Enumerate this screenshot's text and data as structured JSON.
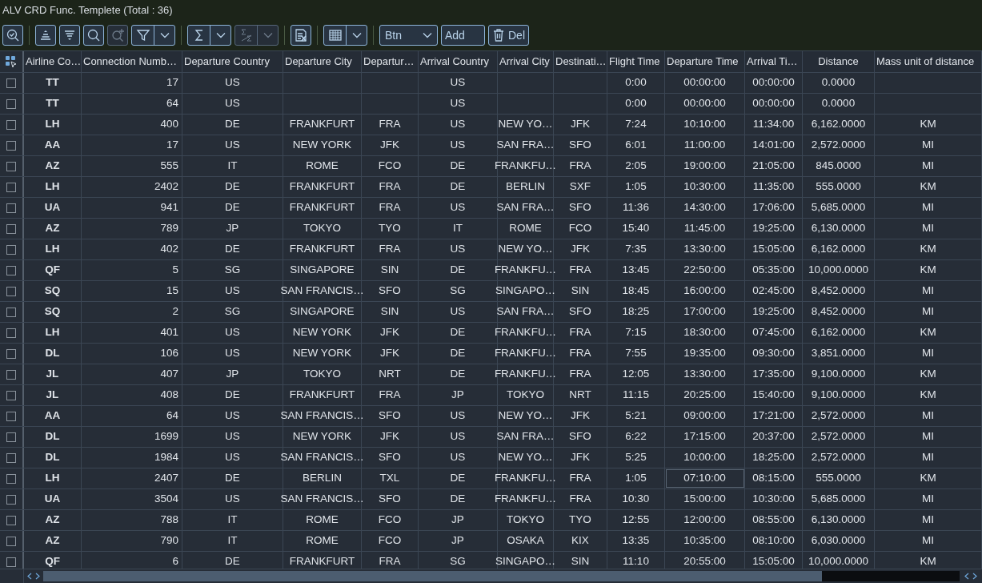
{
  "window": {
    "title": "ALV CRD Func. Templete (Total : 36)"
  },
  "toolbar": [
    {
      "kind": "zoom",
      "disabled": false
    },
    {
      "kind": "separator"
    },
    {
      "kind": "sortup",
      "disabled": false
    },
    {
      "kind": "sortdown",
      "disabled": false
    },
    {
      "kind": "search",
      "disabled": false
    },
    {
      "kind": "zoomin",
      "disabled": true
    },
    {
      "kind": "filter",
      "disabled": false,
      "dropdown": true
    },
    {
      "kind": "separator"
    },
    {
      "kind": "sum",
      "disabled": false,
      "dropdown": true
    },
    {
      "kind": "subtotal",
      "disabled": true,
      "dropdown": true
    },
    {
      "kind": "separator"
    },
    {
      "kind": "export",
      "disabled": false
    },
    {
      "kind": "separator"
    },
    {
      "kind": "layout",
      "disabled": false,
      "dropdown": true
    },
    {
      "kind": "separator"
    },
    {
      "kind": "select",
      "label": "Btn",
      "disabled": false
    },
    {
      "kind": "button",
      "label": "Add",
      "disabled": false
    },
    {
      "kind": "delete",
      "label": "Del",
      "disabled": false
    }
  ],
  "table": {
    "columns": [
      {
        "label": "Airline Co…"
      },
      {
        "label": "Connection Numb…"
      },
      {
        "label": "Departure Country"
      },
      {
        "label": "Departure City"
      },
      {
        "label": "Departur…"
      },
      {
        "label": "Arrival Country"
      },
      {
        "label": "Arrival City"
      },
      {
        "label": "Destinati…"
      },
      {
        "label": "Flight Time"
      },
      {
        "label": "Departure Time"
      },
      {
        "label": "Arrival Ti…"
      },
      {
        "label": "Distance"
      },
      {
        "label": "Mass unit of distance"
      }
    ],
    "rows": [
      {
        "checked": false,
        "current": false,
        "cells": [
          "TT",
          "17",
          "US",
          null,
          null,
          "US",
          null,
          null,
          "0:00",
          "00:00:00",
          "00:00:00",
          "0.0000",
          null
        ]
      },
      {
        "checked": false,
        "current": false,
        "cells": [
          "TT",
          "64",
          "US",
          null,
          null,
          "US",
          null,
          null,
          "0:00",
          "00:00:00",
          "00:00:00",
          "0.0000",
          null
        ]
      },
      {
        "checked": false,
        "current": false,
        "cells": [
          "LH",
          "400",
          "DE",
          "FRANKFURT",
          "FRA",
          "US",
          "NEW YO…",
          "JFK",
          "7:24",
          "10:10:00",
          "11:34:00",
          "6,162.0000",
          "KM"
        ]
      },
      {
        "checked": false,
        "current": false,
        "cells": [
          "AA",
          "17",
          "US",
          "NEW YORK",
          "JFK",
          "US",
          "SAN FRA…",
          "SFO",
          "6:01",
          "11:00:00",
          "14:01:00",
          "2,572.0000",
          "MI"
        ]
      },
      {
        "checked": false,
        "current": false,
        "cells": [
          "AZ",
          "555",
          "IT",
          "ROME",
          "FCO",
          "DE",
          "FRANKFU…",
          "FRA",
          "2:05",
          "19:00:00",
          "21:05:00",
          "845.0000",
          "MI"
        ]
      },
      {
        "checked": false,
        "current": false,
        "cells": [
          "LH",
          "2402",
          "DE",
          "FRANKFURT",
          "FRA",
          "DE",
          "BERLIN",
          "SXF",
          "1:05",
          "10:30:00",
          "11:35:00",
          "555.0000",
          "KM"
        ]
      },
      {
        "checked": false,
        "current": false,
        "cells": [
          "UA",
          "941",
          "DE",
          "FRANKFURT",
          "FRA",
          "US",
          "SAN FRA…",
          "SFO",
          "11:36",
          "14:30:00",
          "17:06:00",
          "5,685.0000",
          "MI"
        ]
      },
      {
        "checked": false,
        "current": false,
        "cells": [
          "AZ",
          "789",
          "JP",
          "TOKYO",
          "TYO",
          "IT",
          "ROME",
          "FCO",
          "15:40",
          "11:45:00",
          "19:25:00",
          "6,130.0000",
          "MI"
        ]
      },
      {
        "checked": false,
        "current": false,
        "cells": [
          "LH",
          "402",
          "DE",
          "FRANKFURT",
          "FRA",
          "US",
          "NEW YO…",
          "JFK",
          "7:35",
          "13:30:00",
          "15:05:00",
          "6,162.0000",
          "KM"
        ]
      },
      {
        "checked": false,
        "current": false,
        "cells": [
          "QF",
          "5",
          "SG",
          "SINGAPORE",
          "SIN",
          "DE",
          "FRANKFU…",
          "FRA",
          "13:45",
          "22:50:00",
          "05:35:00",
          "10,000.0000",
          "KM"
        ]
      },
      {
        "checked": false,
        "current": false,
        "cells": [
          "SQ",
          "15",
          "US",
          "SAN FRANCIS…",
          "SFO",
          "SG",
          "SINGAPO…",
          "SIN",
          "18:45",
          "16:00:00",
          "02:45:00",
          "8,452.0000",
          "MI"
        ]
      },
      {
        "checked": false,
        "current": false,
        "cells": [
          "SQ",
          "2",
          "SG",
          "SINGAPORE",
          "SIN",
          "US",
          "SAN FRA…",
          "SFO",
          "18:25",
          "17:00:00",
          "19:25:00",
          "8,452.0000",
          "MI"
        ]
      },
      {
        "checked": false,
        "current": false,
        "cells": [
          "LH",
          "401",
          "US",
          "NEW YORK",
          "JFK",
          "DE",
          "FRANKFU…",
          "FRA",
          "7:15",
          "18:30:00",
          "07:45:00",
          "6,162.0000",
          "KM"
        ]
      },
      {
        "checked": false,
        "current": false,
        "cells": [
          "DL",
          "106",
          "US",
          "NEW YORK",
          "JFK",
          "DE",
          "FRANKFU…",
          "FRA",
          "7:55",
          "19:35:00",
          "09:30:00",
          "3,851.0000",
          "MI"
        ]
      },
      {
        "checked": false,
        "current": false,
        "cells": [
          "JL",
          "407",
          "JP",
          "TOKYO",
          "NRT",
          "DE",
          "FRANKFU…",
          "FRA",
          "12:05",
          "13:30:00",
          "17:35:00",
          "9,100.0000",
          "KM"
        ]
      },
      {
        "checked": false,
        "current": false,
        "cells": [
          "JL",
          "408",
          "DE",
          "FRANKFURT",
          "FRA",
          "JP",
          "TOKYO",
          "NRT",
          "11:15",
          "20:25:00",
          "15:40:00",
          "9,100.0000",
          "KM"
        ]
      },
      {
        "checked": false,
        "current": false,
        "cells": [
          "AA",
          "64",
          "US",
          "SAN FRANCIS…",
          "SFO",
          "US",
          "NEW YO…",
          "JFK",
          "5:21",
          "09:00:00",
          "17:21:00",
          "2,572.0000",
          "MI"
        ]
      },
      {
        "checked": false,
        "current": false,
        "cells": [
          "DL",
          "1699",
          "US",
          "NEW YORK",
          "JFK",
          "US",
          "SAN FRA…",
          "SFO",
          "6:22",
          "17:15:00",
          "20:37:00",
          "2,572.0000",
          "MI"
        ]
      },
      {
        "checked": false,
        "current": false,
        "cells": [
          "DL",
          "1984",
          "US",
          "SAN FRANCIS…",
          "SFO",
          "US",
          "NEW YO…",
          "JFK",
          "5:25",
          "10:00:00",
          "18:25:00",
          "2,572.0000",
          "MI"
        ]
      },
      {
        "checked": false,
        "current": true,
        "cells": [
          "LH",
          "2407",
          "DE",
          "BERLIN",
          "TXL",
          "DE",
          "FRANKFU…",
          "FRA",
          "1:05",
          "07:10:00",
          "08:15:00",
          "555.0000",
          "KM"
        ]
      },
      {
        "checked": false,
        "current": false,
        "cells": [
          "UA",
          "3504",
          "US",
          "SAN FRANCIS…",
          "SFO",
          "DE",
          "FRANKFU…",
          "FRA",
          "10:30",
          "15:00:00",
          "10:30:00",
          "5,685.0000",
          "MI"
        ]
      },
      {
        "checked": false,
        "current": false,
        "cells": [
          "AZ",
          "788",
          "IT",
          "ROME",
          "FCO",
          "JP",
          "TOKYO",
          "TYO",
          "12:55",
          "12:00:00",
          "08:55:00",
          "6,130.0000",
          "MI"
        ]
      },
      {
        "checked": false,
        "current": false,
        "cells": [
          "AZ",
          "790",
          "IT",
          "ROME",
          "FCO",
          "JP",
          "OSAKA",
          "KIX",
          "13:35",
          "10:35:00",
          "08:10:00",
          "6,030.0000",
          "MI"
        ]
      },
      {
        "checked": false,
        "current": false,
        "cells": [
          "QF",
          "6",
          "DE",
          "FRANKFURT",
          "FRA",
          "SG",
          "SINGAPO…",
          "SIN",
          "11:10",
          "20:55:00",
          "15:05:00",
          "10,000.0000",
          "KM"
        ]
      }
    ]
  }
}
